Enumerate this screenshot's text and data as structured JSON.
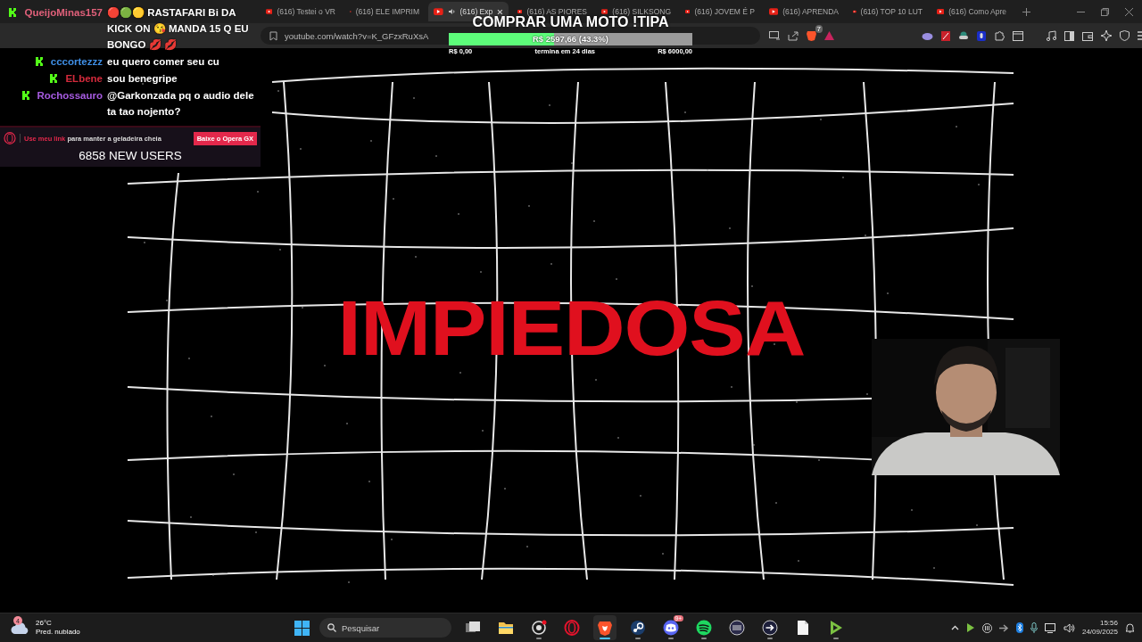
{
  "browser": {
    "tabs": [
      {
        "label": "(616) Testei o VR",
        "selected": false,
        "audio": false
      },
      {
        "label": "(616) ELE IMPRIM",
        "selected": false,
        "audio": false
      },
      {
        "label": "(616) Exp",
        "selected": true,
        "audio": true
      },
      {
        "label": "(616) AS PIORES",
        "selected": false,
        "audio": false
      },
      {
        "label": "(616) SILKSONG",
        "selected": false,
        "audio": false
      },
      {
        "label": "(616) JOVEM É P",
        "selected": false,
        "audio": false
      },
      {
        "label": "(616) APRENDA",
        "selected": false,
        "audio": false
      },
      {
        "label": "(616) TOP 10 LUT",
        "selected": false,
        "audio": false
      },
      {
        "label": "(616) Como Apre",
        "selected": false,
        "audio": false
      }
    ],
    "address": "youtube.com/watch?v=K_GFzxRuXsA",
    "shield_badge": "7"
  },
  "chat": [
    {
      "user": "QueijoMinas157",
      "color": "#e0607a",
      "message": "🔴🟢🟡 RASTAFARI Bi DA KICK ON 😘 MANDA 15 Q EU BONGO 💋 💋"
    },
    {
      "user": "cccortezzz",
      "color": "#3f8fe6",
      "message": "eu quero comer seu cu"
    },
    {
      "user": "ELbene",
      "color": "#d42a3c",
      "message": "sou benegripe"
    },
    {
      "user": "Rochossauro",
      "color": "#a65be0",
      "message": "@Garkonzada pq o audio dele ta tao nojento?"
    }
  ],
  "goal": {
    "title": "COMPRAR UMA MOTO !TIPA",
    "level": 0.433,
    "amount": "R$ 2597,66 (43.3%)",
    "min": "R$ 0,00",
    "ends": "termina em 24 dias",
    "max": "R$ 6000,00"
  },
  "ad": {
    "link": "Use meu link",
    "text": "para manter a geladeira cheia",
    "button": "Baixe o Opera GX"
  },
  "counter": "6858 NEW USERS",
  "headline": "IMPIEDOSA",
  "taskbar": {
    "weather": {
      "badge": "4",
      "temp": "26°C",
      "forecast": "Pred. nublado"
    },
    "search": "Pesquisar",
    "apps": [
      {
        "kind": "taskview",
        "selected": false,
        "running": false
      },
      {
        "kind": "folder",
        "selected": false,
        "running": false
      },
      {
        "kind": "recorder",
        "selected": false,
        "running": true
      },
      {
        "kind": "opera",
        "selected": false,
        "running": false
      },
      {
        "kind": "brave",
        "selected": true,
        "running": true
      },
      {
        "kind": "steam",
        "selected": false,
        "running": true
      },
      {
        "kind": "discord",
        "selected": false,
        "running": true,
        "badge": "9+"
      },
      {
        "kind": "spotify",
        "selected": false,
        "running": true
      },
      {
        "kind": "grid",
        "selected": false,
        "running": false
      },
      {
        "kind": "arrow",
        "selected": false,
        "running": true
      },
      {
        "kind": "file",
        "selected": false,
        "running": false
      },
      {
        "kind": "play",
        "selected": false,
        "running": true
      }
    ],
    "time": "15:56",
    "date": "24/09/2025"
  }
}
